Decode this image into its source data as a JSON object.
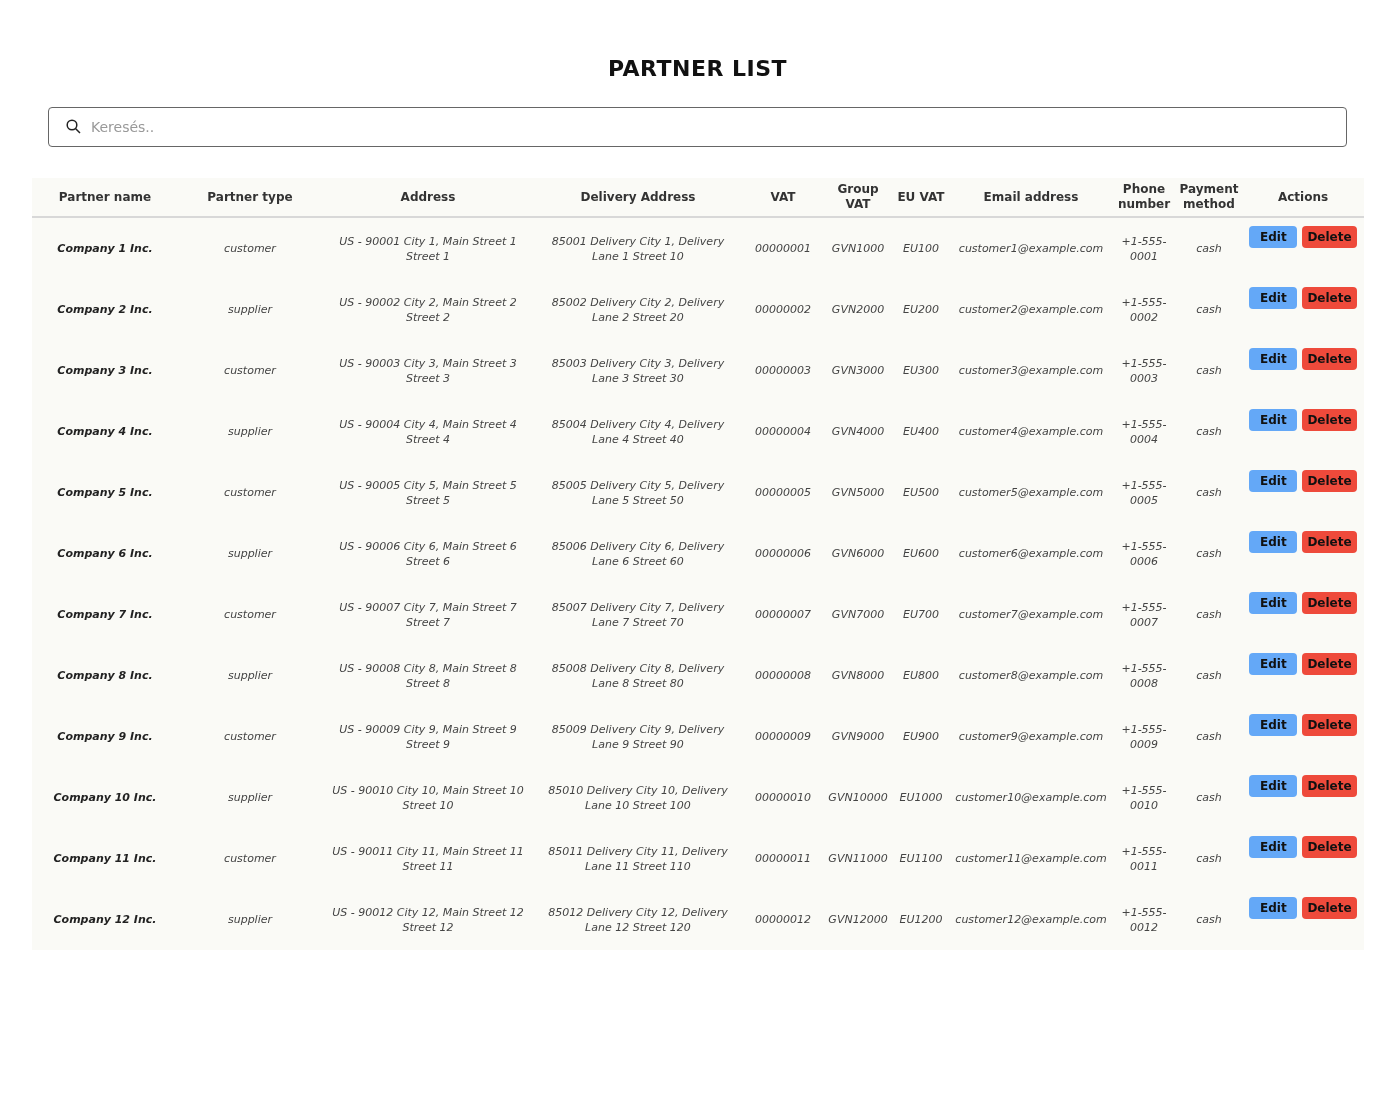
{
  "title": "PARTNER LIST",
  "search": {
    "placeholder": "Keresés.."
  },
  "table": {
    "columns": [
      "Partner name",
      "Partner type",
      "Address",
      "Delivery Address",
      "VAT",
      "Group VAT",
      "EU VAT",
      "Email address",
      "Phone number",
      "Payment method",
      "Actions"
    ],
    "rows": [
      {
        "name": "Company 1 Inc.",
        "type": "customer",
        "address": "US - 90001 City 1, Main Street 1 Street 1",
        "delivery": "85001 Delivery City 1, Delivery Lane 1 Street 10",
        "vat": "00000001",
        "group_vat": "GVN1000",
        "eu_vat": "EU100",
        "email": "customer1@example.com",
        "phone": "+1-555-0001",
        "payment": "cash",
        "actions": [
          {
            "kind": "edit",
            "label": "Edit"
          },
          {
            "kind": "delete",
            "label": "Delete"
          }
        ]
      },
      {
        "name": "Company 2 Inc.",
        "type": "supplier",
        "address": "US - 90002 City 2, Main Street 2 Street 2",
        "delivery": "85002 Delivery City 2, Delivery Lane 2 Street 20",
        "vat": "00000002",
        "group_vat": "GVN2000",
        "eu_vat": "EU200",
        "email": "customer2@example.com",
        "phone": "+1-555-0002",
        "payment": "cash",
        "actions": [
          {
            "kind": "edit",
            "label": "Edit"
          },
          {
            "kind": "delete",
            "label": "Delete"
          }
        ]
      },
      {
        "name": "Company 3 Inc.",
        "type": "customer",
        "address": "US - 90003 City 3, Main Street 3 Street 3",
        "delivery": "85003 Delivery City 3, Delivery Lane 3 Street 30",
        "vat": "00000003",
        "group_vat": "GVN3000",
        "eu_vat": "EU300",
        "email": "customer3@example.com",
        "phone": "+1-555-0003",
        "payment": "cash",
        "actions": [
          {
            "kind": "edit",
            "label": "Edit"
          },
          {
            "kind": "delete",
            "label": "Delete"
          }
        ]
      },
      {
        "name": "Company 4 Inc.",
        "type": "supplier",
        "address": "US - 90004 City 4, Main Street 4 Street 4",
        "delivery": "85004 Delivery City 4, Delivery Lane 4 Street 40",
        "vat": "00000004",
        "group_vat": "GVN4000",
        "eu_vat": "EU400",
        "email": "customer4@example.com",
        "phone": "+1-555-0004",
        "payment": "cash",
        "actions": [
          {
            "kind": "edit",
            "label": "Edit"
          },
          {
            "kind": "delete",
            "label": "Delete"
          }
        ]
      },
      {
        "name": "Company 5 Inc.",
        "type": "customer",
        "address": "US - 90005 City 5, Main Street 5 Street 5",
        "delivery": "85005 Delivery City 5, Delivery Lane 5 Street 50",
        "vat": "00000005",
        "group_vat": "GVN5000",
        "eu_vat": "EU500",
        "email": "customer5@example.com",
        "phone": "+1-555-0005",
        "payment": "cash",
        "actions": [
          {
            "kind": "edit",
            "label": "Edit"
          },
          {
            "kind": "delete",
            "label": "Delete"
          }
        ]
      },
      {
        "name": "Company 6 Inc.",
        "type": "supplier",
        "address": "US - 90006 City 6, Main Street 6 Street 6",
        "delivery": "85006 Delivery City 6, Delivery Lane 6 Street 60",
        "vat": "00000006",
        "group_vat": "GVN6000",
        "eu_vat": "EU600",
        "email": "customer6@example.com",
        "phone": "+1-555-0006",
        "payment": "cash",
        "actions": [
          {
            "kind": "edit",
            "label": "Edit"
          },
          {
            "kind": "delete",
            "label": "Delete"
          }
        ]
      },
      {
        "name": "Company 7 Inc.",
        "type": "customer",
        "address": "US - 90007 City 7, Main Street 7 Street 7",
        "delivery": "85007 Delivery City 7, Delivery Lane 7 Street 70",
        "vat": "00000007",
        "group_vat": "GVN7000",
        "eu_vat": "EU700",
        "email": "customer7@example.com",
        "phone": "+1-555-0007",
        "payment": "cash",
        "actions": [
          {
            "kind": "edit",
            "label": "Edit"
          },
          {
            "kind": "delete",
            "label": "Delete"
          }
        ]
      },
      {
        "name": "Company 8 Inc.",
        "type": "supplier",
        "address": "US - 90008 City 8, Main Street 8 Street 8",
        "delivery": "85008 Delivery City 8, Delivery Lane 8 Street 80",
        "vat": "00000008",
        "group_vat": "GVN8000",
        "eu_vat": "EU800",
        "email": "customer8@example.com",
        "phone": "+1-555-0008",
        "payment": "cash",
        "actions": [
          {
            "kind": "edit",
            "label": "Edit"
          },
          {
            "kind": "delete",
            "label": "Delete"
          }
        ]
      },
      {
        "name": "Company 9 Inc.",
        "type": "customer",
        "address": "US - 90009 City 9, Main Street 9 Street 9",
        "delivery": "85009 Delivery City 9, Delivery Lane 9 Street 90",
        "vat": "00000009",
        "group_vat": "GVN9000",
        "eu_vat": "EU900",
        "email": "customer9@example.com",
        "phone": "+1-555-0009",
        "payment": "cash",
        "actions": [
          {
            "kind": "edit",
            "label": "Edit"
          },
          {
            "kind": "delete",
            "label": "Delete"
          }
        ]
      },
      {
        "name": "Company 10 Inc.",
        "type": "supplier",
        "address": "US - 90010 City 10, Main Street 10 Street 10",
        "delivery": "85010 Delivery City 10, Delivery Lane 10 Street 100",
        "vat": "00000010",
        "group_vat": "GVN10000",
        "eu_vat": "EU1000",
        "email": "customer10@example.com",
        "phone": "+1-555-0010",
        "payment": "cash",
        "actions": [
          {
            "kind": "edit",
            "label": "Edit"
          },
          {
            "kind": "delete",
            "label": "Delete"
          }
        ]
      },
      {
        "name": "Company 11 Inc.",
        "type": "customer",
        "address": "US - 90011 City 11, Main Street 11 Street 11",
        "delivery": "85011 Delivery City 11, Delivery Lane 11 Street 110",
        "vat": "00000011",
        "group_vat": "GVN11000",
        "eu_vat": "EU1100",
        "email": "customer11@example.com",
        "phone": "+1-555-0011",
        "payment": "cash",
        "actions": [
          {
            "kind": "edit",
            "label": "Edit"
          },
          {
            "kind": "delete",
            "label": "Delete"
          }
        ]
      },
      {
        "name": "Company 12 Inc.",
        "type": "supplier",
        "address": "US - 90012 City 12, Main Street 12 Street 12",
        "delivery": "85012 Delivery City 12, Delivery Lane 12 Street 120",
        "vat": "00000012",
        "group_vat": "GVN12000",
        "eu_vat": "EU1200",
        "email": "customer12@example.com",
        "phone": "+1-555-0012",
        "payment": "cash",
        "actions": [
          {
            "kind": "edit",
            "label": "Edit"
          },
          {
            "kind": "delete",
            "label": "Delete"
          }
        ]
      }
    ]
  }
}
